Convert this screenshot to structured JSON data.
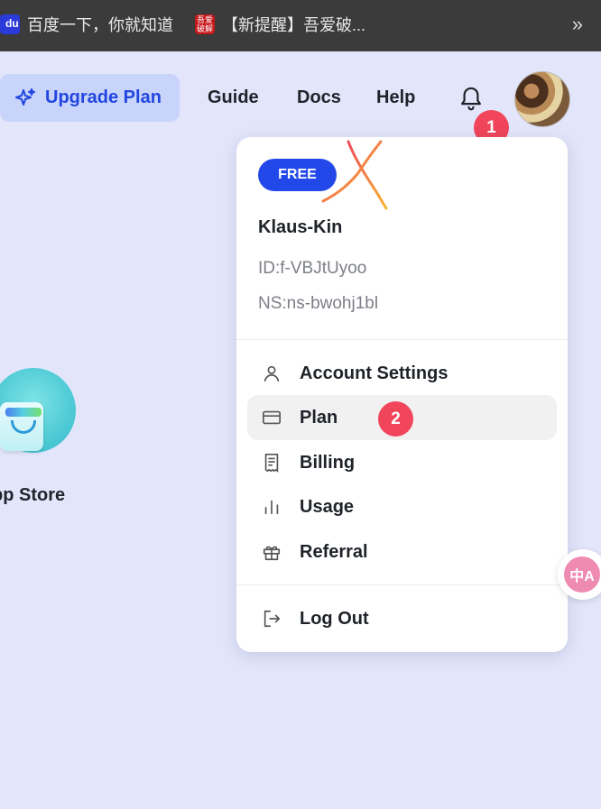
{
  "bookmarks": {
    "items": [
      {
        "label": "百度一下，你就知道",
        "icon": "baidu-icon"
      },
      {
        "label": "【新提醒】吾爱破...",
        "icon": "seal-icon",
        "icon_text": "吾爱破解"
      }
    ],
    "overflow_icon": "»"
  },
  "header": {
    "upgrade_label": "Upgrade Plan",
    "nav": [
      "Guide",
      "Docs",
      "Help"
    ]
  },
  "annotations": {
    "step1": "1",
    "step2": "2"
  },
  "desktop": {
    "app_label": "pp Store"
  },
  "menu": {
    "plan_badge": "FREE",
    "username": "Klaus-Kin",
    "id_text": "ID:f-VBJtUyoo",
    "ns_text": "NS:ns-bwohj1bl",
    "items": [
      {
        "label": "Account Settings",
        "icon": "user-icon"
      },
      {
        "label": "Plan",
        "icon": "card-icon"
      },
      {
        "label": "Billing",
        "icon": "receipt-icon"
      },
      {
        "label": "Usage",
        "icon": "bar-chart-icon"
      },
      {
        "label": "Referral",
        "icon": "gift-icon"
      }
    ],
    "logout_label": "Log Out"
  },
  "translate_widget": {
    "label": "中A"
  },
  "colors": {
    "accent": "#2248ea",
    "background": "#e3e6fb",
    "badge": "#f0455a",
    "bookmark_bar": "#3b3b3b"
  }
}
